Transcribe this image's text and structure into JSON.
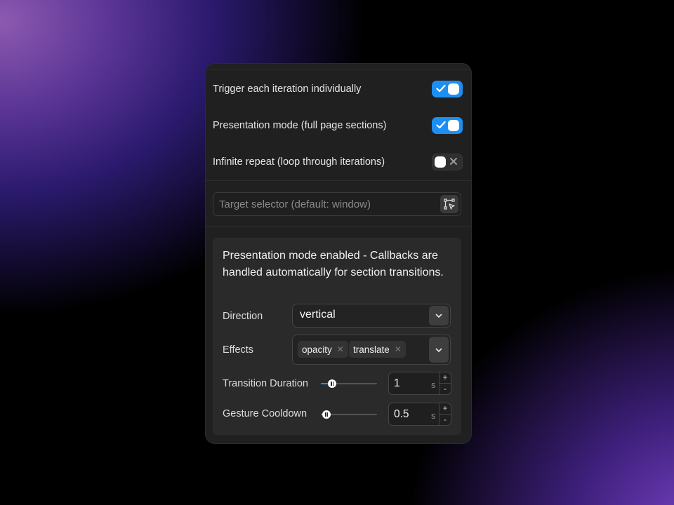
{
  "toggles": [
    {
      "label": "Trigger each iteration individually",
      "state": "on"
    },
    {
      "label": "Presentation mode (full page sections)",
      "state": "on"
    },
    {
      "label": "Infinite repeat (loop through iterations)",
      "state": "off"
    }
  ],
  "target": {
    "placeholder": "Target selector (default: window)",
    "value": ""
  },
  "info": {
    "text": "Presentation mode enabled - Callbacks are handled automatically for section transitions."
  },
  "direction": {
    "label": "Direction",
    "value": "vertical"
  },
  "effects": {
    "label": "Effects",
    "chips": [
      "opacity",
      "translate"
    ]
  },
  "transition": {
    "label": "Transition Duration",
    "value": "1",
    "unit": "s",
    "slider_fraction": 0.2
  },
  "cooldown": {
    "label": "Gesture Cooldown",
    "value": "0.5",
    "unit": "s",
    "slider_fraction": 0.1
  },
  "stepper": {
    "plus": "+",
    "minus": "-"
  },
  "colors": {
    "accent": "#1e8ff2",
    "panel": "#202020"
  }
}
